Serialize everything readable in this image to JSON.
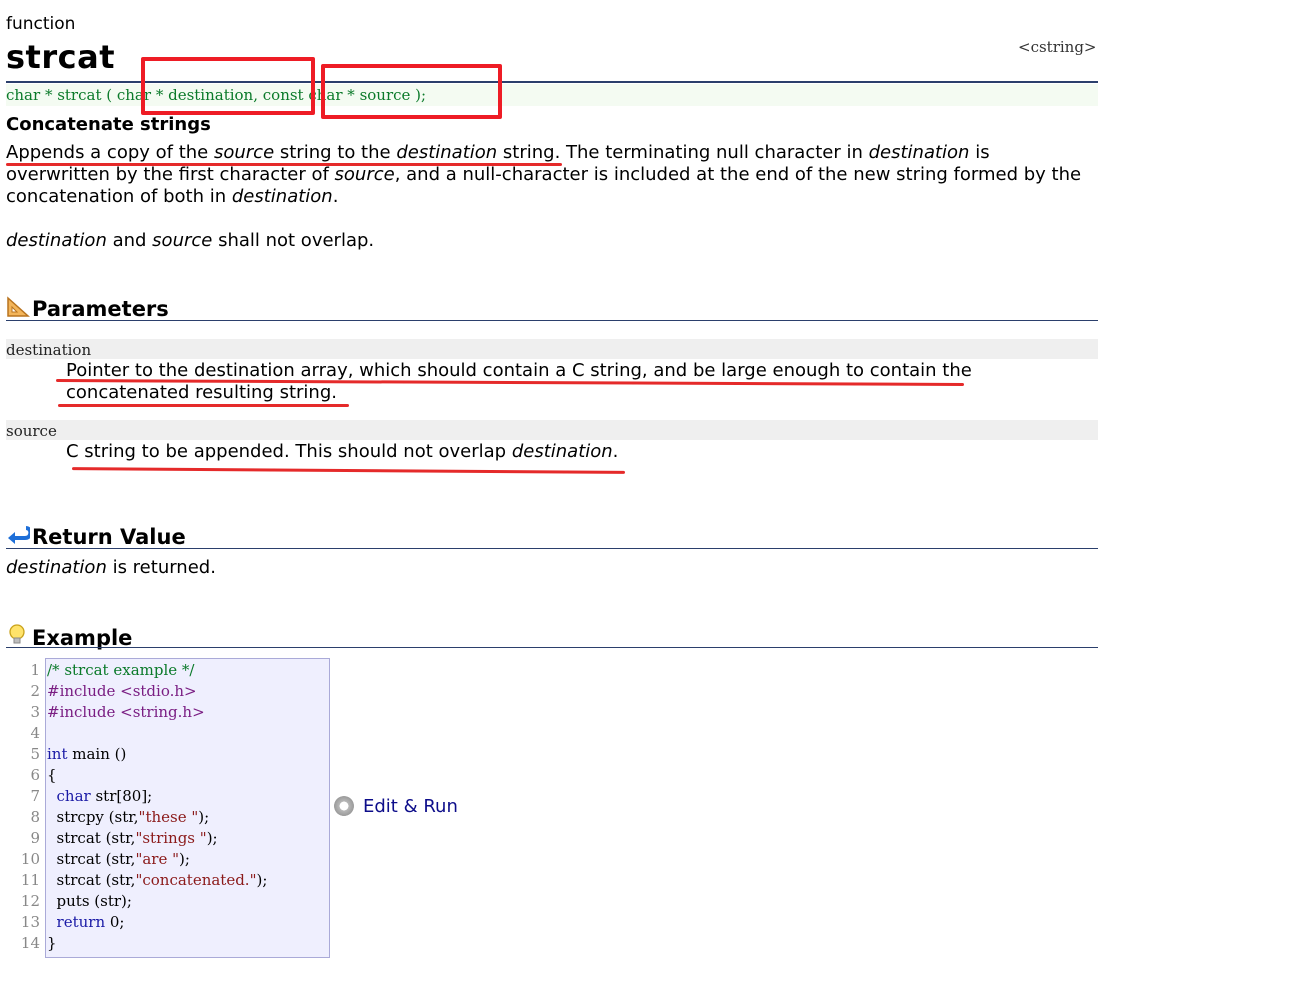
{
  "kind": "function",
  "title": "strcat",
  "header_link": "<cstring>",
  "prototype": {
    "part1": "char * strcat ( ",
    "param1": "char * destination",
    "sep": ", ",
    "param2": "const char * source",
    "part2": " );"
  },
  "subtitle": "Concatenate strings",
  "description": {
    "t1": "Appends a copy of the ",
    "e1": "source",
    "t2": " string to the ",
    "e2": "destination",
    "t3": " string. The terminating null character in ",
    "e3": "destination",
    "t4": " is overwritten by the first character of ",
    "e4": "source",
    "t5": ", and a null-character is included at the end of the new string formed by the concatenation of both in ",
    "e5": "destination",
    "t6": "."
  },
  "overlap_note": {
    "e1": "destination",
    "t1": " and ",
    "e2": "source",
    "t2": " shall not overlap."
  },
  "sections": {
    "parameters": "Parameters",
    "return_value": "Return Value",
    "example": "Example"
  },
  "parameters": [
    {
      "name": "destination",
      "desc": "Pointer to the destination array, which should contain a C string, and be large enough to contain the concatenated resulting string."
    },
    {
      "name": "source",
      "desc_text": "C string to be appended. This should not overlap ",
      "desc_em": "destination",
      "desc_end": "."
    }
  ],
  "return_value": {
    "em": "destination",
    "text": " is returned."
  },
  "code": {
    "line_numbers": [
      "1",
      "2",
      "3",
      "4",
      "5",
      "6",
      "7",
      "8",
      "9",
      "10",
      "11",
      "12",
      "13",
      "14"
    ],
    "lines": [
      "/* strcat example */",
      "#include <stdio.h>",
      "#include <string.h>",
      "",
      "int main ()",
      "{",
      "  char str[80];",
      "  strcpy (str,\"these \");",
      "  strcat (str,\"strings \");",
      "  strcat (str,\"are \");",
      "  strcat (str,\"concatenated.\");",
      "  puts (str);",
      "  return 0;",
      "}"
    ]
  },
  "edit_run": "Edit & Run",
  "icons": {
    "parameters": "ruler-triangle-icon",
    "return_value": "return-arrow-icon",
    "example": "lightbulb-icon",
    "edit_run": "gear-icon"
  },
  "colors": {
    "prototype_text": "#0b7a2a",
    "annotation_red": "#ee1c25",
    "rule": "#2b3f6c",
    "code_bg": "#efeffe"
  }
}
